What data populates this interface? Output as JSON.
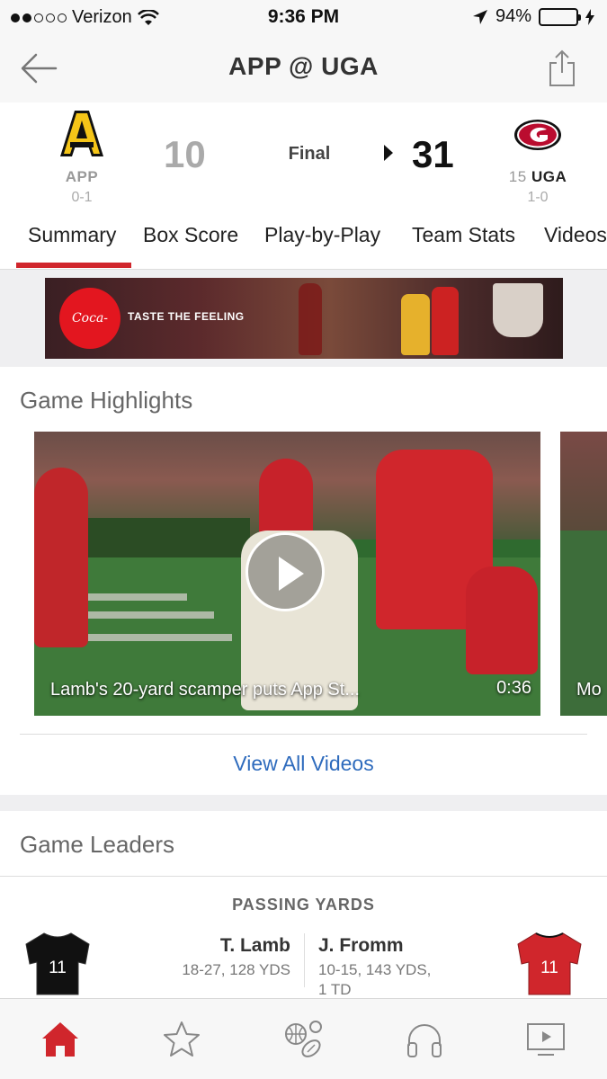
{
  "status_bar": {
    "carrier": "Verizon",
    "time": "9:36 PM",
    "battery": "94%",
    "battery_level": 0.94
  },
  "nav": {
    "title": "APP @ UGA",
    "back_icon": "back-arrow-icon",
    "share_icon": "share-icon"
  },
  "scoreboard": {
    "away": {
      "abbr": "APP",
      "record": "0-1",
      "score": "10",
      "color": "#f5c518"
    },
    "home": {
      "rank": "15",
      "abbr": "UGA",
      "record": "1-0",
      "score": "31",
      "color": "#ba0c2f"
    },
    "status": "Final"
  },
  "tabs": [
    {
      "label": "Summary",
      "active": true
    },
    {
      "label": "Box Score"
    },
    {
      "label": "Play-by-Play"
    },
    {
      "label": "Team Stats"
    },
    {
      "label": "Videos"
    }
  ],
  "ad": {
    "brand": "Coca-Cola",
    "tagline": "TASTE THE FEELING"
  },
  "highlights": {
    "title": "Game Highlights",
    "videos": [
      {
        "caption": "Lamb's 20-yard scamper puts App St...",
        "duration": "0:36"
      },
      {
        "caption": "Mo"
      }
    ],
    "view_all": "View All Videos"
  },
  "leaders": {
    "title": "Game Leaders",
    "category": "PASSING YARDS",
    "away": {
      "name": "T. Lamb",
      "line1": "18-27, 128 YDS",
      "jersey_number": "11",
      "jersey_color": "#111111"
    },
    "home": {
      "name": "J. Fromm",
      "line1": "10-15, 143 YDS,",
      "line2": "1 TD",
      "jersey_number": "11",
      "jersey_color": "#d0262c"
    }
  },
  "tab_bar": {
    "items": [
      "home-icon",
      "favorites-star-icon",
      "sports-balls-icon",
      "podcasts-headphones-icon",
      "watch-video-icon"
    ],
    "accent": "#d0262c"
  }
}
